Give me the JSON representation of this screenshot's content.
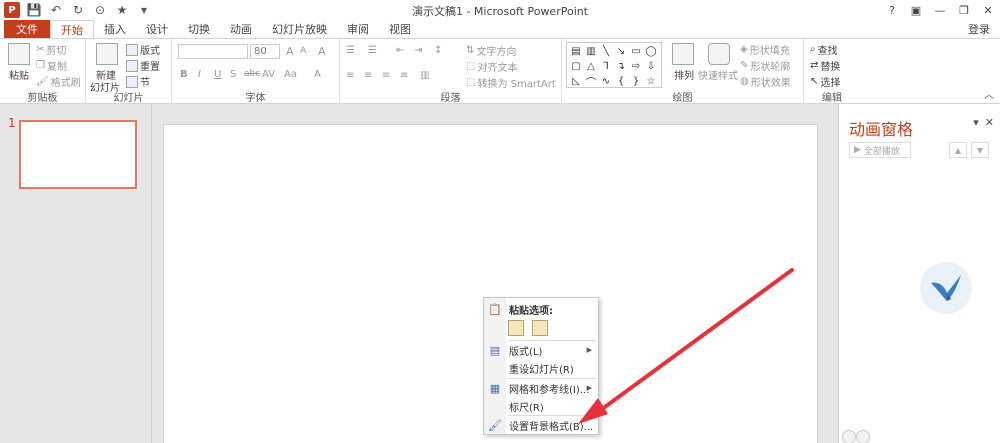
{
  "window": {
    "title": "演示文稿1 - Microsoft PowerPoint",
    "app_icon": "P",
    "controls": [
      "?",
      "▣",
      "—",
      "❐",
      "✕"
    ]
  },
  "tabs": [
    {
      "label": "文件",
      "kind": "file"
    },
    {
      "label": "开始",
      "kind": "active"
    },
    {
      "label": "插入"
    },
    {
      "label": "设计"
    },
    {
      "label": "切换"
    },
    {
      "label": "动画"
    },
    {
      "label": "幻灯片放映"
    },
    {
      "label": "审阅"
    },
    {
      "label": "视图"
    }
  ],
  "login": "登录",
  "ribbon": {
    "clipboard": {
      "label": "剪贴板",
      "paste": "粘贴",
      "cut": "剪切",
      "copy": "复制",
      "format_painter": "格式刷"
    },
    "slides": {
      "label": "幻灯片",
      "new_slide": "新建",
      "new_slide_2": "幻灯片",
      "layout": "版式",
      "reset": "重置",
      "section": "节"
    },
    "font": {
      "label": "字体",
      "size": "80",
      "bold": "B",
      "italic": "I",
      "underline": "U",
      "strike": "S",
      "shadow": "abc",
      "spacing": "AV",
      "case": "Aa",
      "color": "A",
      "grow": "A",
      "shrink": "A",
      "clear": "A"
    },
    "paragraph": {
      "label": "段落",
      "text_direction": "文字方向",
      "align_text": "对齐文本",
      "smartart": "转换为 SmartArt"
    },
    "drawing": {
      "label": "绘图",
      "arrange": "排列",
      "quick_styles": "快速样式",
      "fill": "形状填充",
      "outline": "形状轮廓",
      "effects": "形状效果"
    },
    "editing": {
      "label": "编辑",
      "find": "查找",
      "replace": "替换",
      "select": "选择"
    }
  },
  "slide_panel": {
    "number": "1"
  },
  "animation_pane": {
    "title": "动画窗格",
    "play_all": "全部播放"
  },
  "context_menu": {
    "paste_options": "粘贴选项:",
    "layout": "版式(L)",
    "reset_slide": "重设幻灯片(R)",
    "grid_guides": "网格和参考线(I)...",
    "ruler": "标尺(R)",
    "format_background": "设置背景格式(B)..."
  },
  "colors": {
    "accent": "#c43e1c",
    "arrow": "#e8303a"
  }
}
